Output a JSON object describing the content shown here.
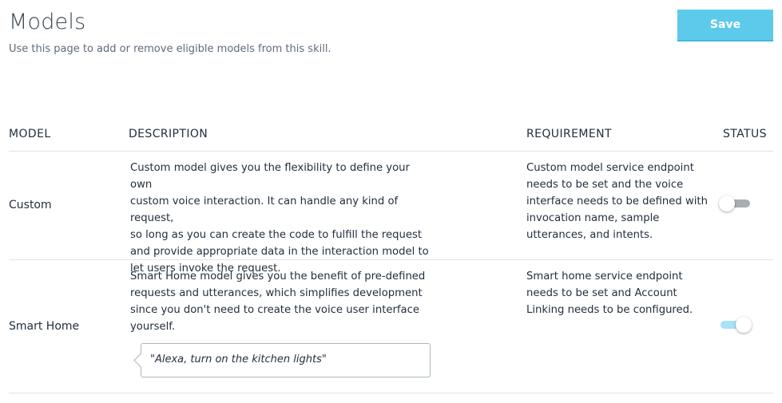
{
  "page": {
    "title": "Models",
    "subtitle": "Use this page to add or remove eligible models from this skill.",
    "save_label": "Save"
  },
  "table": {
    "headers": {
      "model": "MODEL",
      "description": "DESCRIPTION",
      "requirement": "REQUIREMENT",
      "status": "STATUS"
    },
    "rows": [
      {
        "name": "Custom",
        "description_lines": [
          "Custom model gives you the flexibility to define your own",
          "custom voice interaction. It can handle any kind of request,",
          "so long as you can create the code to fulfill the request",
          "and provide appropriate data in the interaction model to",
          "let users invoke the request."
        ],
        "requirement_lines": [
          "Custom model service endpoint",
          "needs to be set and the voice",
          "interface needs to be defined with",
          "invocation name, sample",
          "utterances, and intents."
        ],
        "status": "off"
      },
      {
        "name": "Smart Home",
        "description_lines": [
          "Smart Home model gives you the benefit of pre-defined",
          "requests and utterances, which simplifies development",
          "since you don't need to create the voice user interface",
          "yourself."
        ],
        "requirement_lines": [
          "Smart home service endpoint",
          "needs to be set and Account",
          "Linking needs to be configured."
        ],
        "example": "\"Alexa, turn on the kitchen lights\"",
        "status": "on"
      }
    ]
  },
  "colors": {
    "accent": "#5dcaeb",
    "toggle_off_track": "#a9adb2",
    "toggle_on_track": "#a8e2f5",
    "divider": "#e2e4e6"
  }
}
